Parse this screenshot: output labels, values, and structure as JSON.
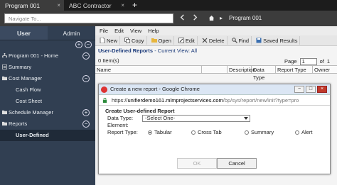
{
  "tabs": [
    {
      "label": "Program 001",
      "close": "×"
    },
    {
      "label": "ABC Contractor",
      "close": "×"
    }
  ],
  "new_tab": "+",
  "nav": {
    "placeholder": "Navigate To...",
    "crumb_sep": "▸",
    "crumb": "Program 001"
  },
  "sidebar": {
    "tabs": [
      "User",
      "Admin"
    ],
    "items": [
      {
        "label": "Program 001 - Home",
        "toggle": "−"
      },
      {
        "label": "Summary"
      },
      {
        "label": "Cost Manager",
        "toggle": "−"
      },
      {
        "label": "Cash Flow"
      },
      {
        "label": "Cost Sheet"
      },
      {
        "label": "Schedule Manager",
        "toggle": "+"
      },
      {
        "label": "Reports",
        "toggle": "−"
      },
      {
        "label": "User-Defined"
      }
    ]
  },
  "menu": [
    "File",
    "Edit",
    "View",
    "Help"
  ],
  "toolbar": [
    "New",
    "Copy",
    "Open",
    "Edit",
    "Delete",
    "Find",
    "Saved Results"
  ],
  "heading": {
    "title": "User-Defined Reports",
    "current_view_label": " - Current View:",
    "current_view": "All"
  },
  "count": "0 Item(s)",
  "pager": {
    "label": "Page",
    "value": "1",
    "of": "of",
    "total": "1"
  },
  "columns": [
    "Name",
    "Description",
    "Data Type",
    "Report Type",
    "Owner"
  ],
  "dialog": {
    "title": "Create a new report - Google Chrome",
    "url_scheme": "https://",
    "url_host": "unifierdemo161.mlmprojectservices.com",
    "url_path": "/bp/sys/report/new/init?type=pro",
    "form_title": "Create User-defined Report",
    "data_type_label": "Data Type:",
    "data_type_value": "-Select One-",
    "element_label": "Element:",
    "report_type_label": "Report Type:",
    "report_types": [
      "Tabular",
      "Cross Tab",
      "Summary",
      "Alert"
    ],
    "selected_report_type": "Tabular",
    "ok_label": "OK",
    "cancel_label": "Cancel"
  }
}
